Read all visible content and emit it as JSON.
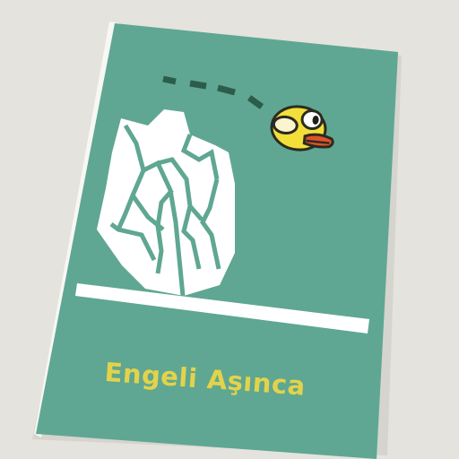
{
  "book": {
    "title": "Engeli Aşınca"
  },
  "colors": {
    "background": "#e4e3de",
    "cover": "#5fa792",
    "rock": "#ffffff",
    "ground_line": "#ffffff",
    "dash_path": "#2c5c4a",
    "bird_body": "#f2df3a",
    "bird_beak": "#e1522a",
    "title_text": "#e3d34a"
  },
  "illustration": {
    "subject": "bird-icon",
    "obstacle": "rock-icon"
  }
}
